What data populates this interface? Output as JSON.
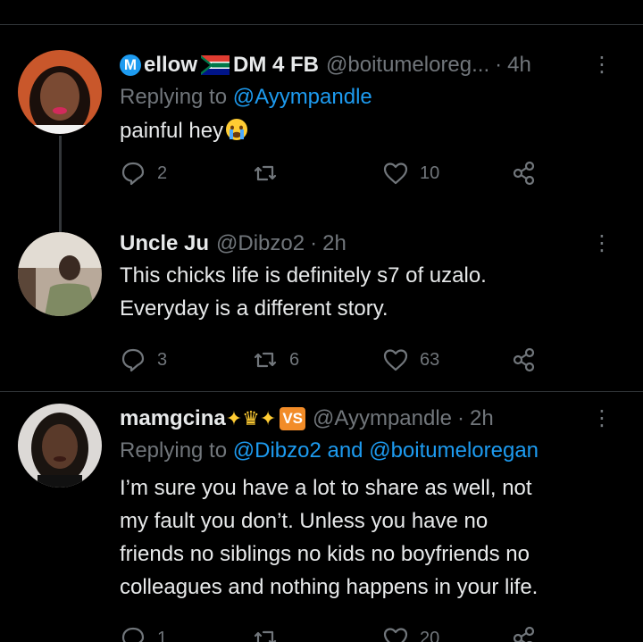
{
  "tweets": [
    {
      "name": "ellow",
      "name_badge": "M",
      "name_suffix": "DM 4 FB",
      "handle": "@boitumeloreg...",
      "time": "4h",
      "reply_prefix": "Replying to",
      "reply_mentions": "@Ayympandle",
      "text": "painful hey",
      "emoji": "crying-face",
      "replies": "2",
      "retweets": "",
      "likes": "10"
    },
    {
      "name": "Uncle Ju",
      "handle": "@Dibzo2",
      "time": "2h",
      "text_lines": [
        "This chicks life is definitely s7 of uzalo.",
        "Everyday is a different story."
      ],
      "replies": "3",
      "retweets": "6",
      "likes": "63"
    },
    {
      "name": "mamgcina",
      "handle": "@Ayympandle",
      "time": "2h",
      "reply_prefix": "Replying to",
      "reply_mentions": "@Dibzo2 and @boitumeloregan",
      "text_lines": [
        "I’m sure you have a lot to share as well, not",
        "my fault you don’t. Unless you have no",
        "friends no siblings no kids no boyfriends no",
        "colleagues and nothing happens in your life."
      ],
      "replies": "1",
      "retweets": "",
      "likes": "20"
    }
  ],
  "colors": {
    "background": "#000000",
    "text": "#e7e9ea",
    "secondary": "#71767b",
    "mention": "#1d9bf0",
    "divider": "#2f3336"
  },
  "more_glyph": "⋮",
  "dot": "·"
}
